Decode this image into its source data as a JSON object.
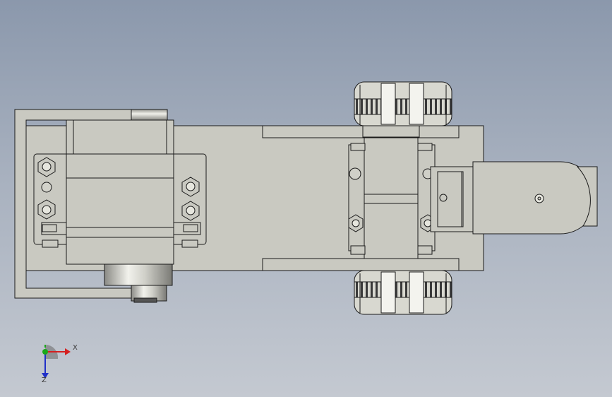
{
  "viewport": {
    "background_top": "#8b98ac",
    "background_bottom": "#c4c9d1"
  },
  "model": {
    "part_fill": "#c9c9c1",
    "edge_color": "#1a1a1a",
    "tire_color": "#2a2a2a",
    "wheel_highlight": "#e8e8e0",
    "description_items": [
      "servo-motor",
      "chassis-plate",
      "rear-axle-bracket",
      "front-wheel-top",
      "front-wheel-bottom",
      "caster-mount",
      "wheel-arc-guard",
      "gear-hub"
    ]
  },
  "triad": {
    "x_label": "X",
    "y_label": "Y",
    "z_label": "Z",
    "x_color": "#d42020",
    "y_color": "#18a818",
    "z_color": "#2030c8"
  }
}
